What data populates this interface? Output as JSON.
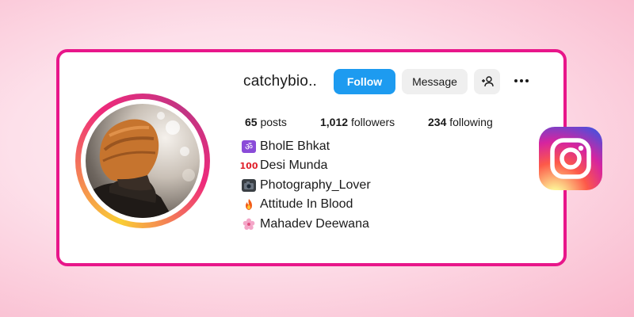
{
  "profile": {
    "username": "catchybio..",
    "follow_label": "Follow",
    "message_label": "Message"
  },
  "stats": {
    "posts_count": "65",
    "posts_label": "posts",
    "followers_count": "1,012",
    "followers_label": "followers",
    "following_count": "234",
    "following_label": "following"
  },
  "bio": {
    "lines": [
      {
        "icon": "om-icon",
        "text": "BholE Bhkat"
      },
      {
        "icon": "hundred-points-icon",
        "text": "Desi Munda"
      },
      {
        "icon": "camera-icon",
        "text": "Photography_Lover"
      },
      {
        "icon": "fire-icon",
        "text": "Attitude In Blood"
      },
      {
        "icon": "flower-icon",
        "text": "Mahadev Deewana"
      }
    ]
  },
  "colors": {
    "card_border": "#e8168a",
    "follow_button": "#1d9bf0",
    "secondary_button": "#efefef"
  }
}
